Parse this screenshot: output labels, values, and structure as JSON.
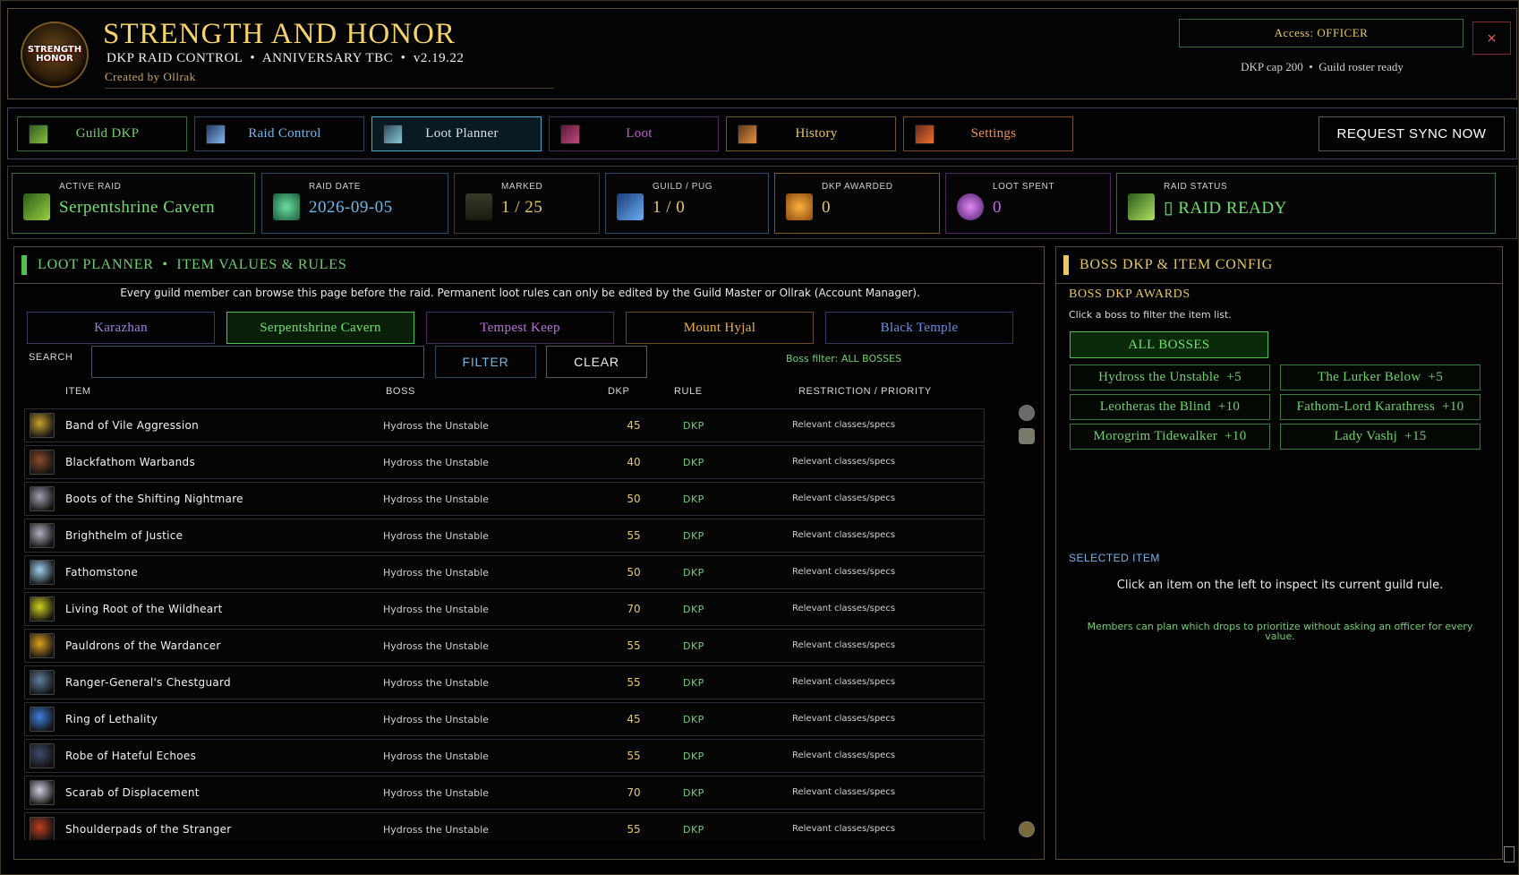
{
  "header": {
    "logo_text": "STRENGTH\nHONOR",
    "title": "STRENGTH AND HONOR",
    "subtitle": "DKP RAID CONTROL  •  ANNIVERSARY TBC  •  v2.19.22",
    "creator": "Created by Ollrak",
    "access": "Access: OFFICER",
    "close": "×",
    "status_line": "DKP cap 200  •  Guild roster ready"
  },
  "nav": {
    "tabs": [
      {
        "label": "Guild DKP",
        "color": "#6fd06f",
        "icon": "guild-dkp-icon"
      },
      {
        "label": "Raid Control",
        "color": "#6fb8e8",
        "icon": "raid-control-icon"
      },
      {
        "label": "Loot Planner",
        "color": "#d8e0e8",
        "icon": "loot-planner-icon"
      },
      {
        "label": "Loot",
        "color": "#c060d0",
        "icon": "loot-icon"
      },
      {
        "label": "History",
        "color": "#e8c860",
        "icon": "history-icon"
      },
      {
        "label": "Settings",
        "color": "#f09050",
        "icon": "settings-icon"
      }
    ],
    "sync": "REQUEST SYNC NOW"
  },
  "stats": [
    {
      "label": "ACTIVE RAID",
      "value": "Serpentshrine Cavern",
      "color": "#6fe06f"
    },
    {
      "label": "RAID DATE",
      "value": "2026-09-05",
      "color": "#6fb8e8"
    },
    {
      "label": "MARKED",
      "value": "1 / 25",
      "color": "#e8c860"
    },
    {
      "label": "GUILD / PUG",
      "value": "1 / 0",
      "color": "#e8c860"
    },
    {
      "label": "DKP AWARDED",
      "value": "0",
      "color": "#e8c860"
    },
    {
      "label": "LOOT SPENT",
      "value": "0",
      "color": "#c070e0"
    },
    {
      "label": "RAID STATUS",
      "value": "▯ RAID READY",
      "color": "#6fe06f"
    }
  ],
  "loot": {
    "title": "LOOT PLANNER  •  ITEM VALUES & RULES",
    "notice": "Every guild member can browse this page before the raid. Permanent loot rules can only be edited by the Guild Master or Ollrak (Account Manager).",
    "raids": [
      "Karazhan",
      "Serpentshrine Cavern",
      "Tempest Keep",
      "Mount Hyjal",
      "Black Temple"
    ],
    "search_label": "SEARCH",
    "search_value": "",
    "filter": "FILTER",
    "clear": "CLEAR",
    "boss_filter": "Boss filter: ALL BOSSES",
    "columns": [
      "ITEM",
      "BOSS",
      "DKP",
      "RULE",
      "RESTRICTION / PRIORITY"
    ],
    "items": [
      {
        "name": "Band of Vile Aggression",
        "boss": "Hydross the Unstable",
        "dkp": "45",
        "rule": "DKP",
        "restriction": "Relevant classes/specs",
        "icon": "ring-icon"
      },
      {
        "name": "Blackfathom Warbands",
        "boss": "Hydross the Unstable",
        "dkp": "40",
        "rule": "DKP",
        "restriction": "Relevant classes/specs",
        "icon": "bracers-icon"
      },
      {
        "name": "Boots of the Shifting Nightmare",
        "boss": "Hydross the Unstable",
        "dkp": "50",
        "rule": "DKP",
        "restriction": "Relevant classes/specs",
        "icon": "boots-icon"
      },
      {
        "name": "Brighthelm of Justice",
        "boss": "Hydross the Unstable",
        "dkp": "55",
        "rule": "DKP",
        "restriction": "Relevant classes/specs",
        "icon": "helm-icon"
      },
      {
        "name": "Fathomstone",
        "boss": "Hydross the Unstable",
        "dkp": "50",
        "rule": "DKP",
        "restriction": "Relevant classes/specs",
        "icon": "stone-icon"
      },
      {
        "name": "Living Root of the Wildheart",
        "boss": "Hydross the Unstable",
        "dkp": "70",
        "rule": "DKP",
        "restriction": "Relevant classes/specs",
        "icon": "root-icon"
      },
      {
        "name": "Pauldrons of the Wardancer",
        "boss": "Hydross the Unstable",
        "dkp": "55",
        "rule": "DKP",
        "restriction": "Relevant classes/specs",
        "icon": "pauldrons-icon"
      },
      {
        "name": "Ranger-General's Chestguard",
        "boss": "Hydross the Unstable",
        "dkp": "55",
        "rule": "DKP",
        "restriction": "Relevant classes/specs",
        "icon": "chest-icon"
      },
      {
        "name": "Ring of Lethality",
        "boss": "Hydross the Unstable",
        "dkp": "45",
        "rule": "DKP",
        "restriction": "Relevant classes/specs",
        "icon": "ring-blue-icon"
      },
      {
        "name": "Robe of Hateful Echoes",
        "boss": "Hydross the Unstable",
        "dkp": "55",
        "rule": "DKP",
        "restriction": "Relevant classes/specs",
        "icon": "robe-icon"
      },
      {
        "name": "Scarab of Displacement",
        "boss": "Hydross the Unstable",
        "dkp": "70",
        "rule": "DKP",
        "restriction": "Relevant classes/specs",
        "icon": "scarab-icon"
      },
      {
        "name": "Shoulderpads of the Stranger",
        "boss": "Hydross the Unstable",
        "dkp": "55",
        "rule": "DKP",
        "restriction": "Relevant classes/specs",
        "icon": "shoulder-icon"
      }
    ]
  },
  "boss": {
    "title": "BOSS DKP & ITEM CONFIG",
    "section": "BOSS DKP AWARDS",
    "hint": "Click a boss to filter the item list.",
    "all": "ALL BOSSES",
    "bosses": [
      "Hydross the Unstable  +5",
      "The Lurker Below  +5",
      "Leotheras the Blind  +10",
      "Fathom-Lord Karathress  +10",
      "Morogrim Tidewalker  +10",
      "Lady Vashj  +15"
    ],
    "selected_title": "SELECTED ITEM",
    "selected_desc": "Click an item on the left to inspect its current guild rule.",
    "selected_note": "Members can plan which drops to prioritize without asking an officer for every value."
  }
}
